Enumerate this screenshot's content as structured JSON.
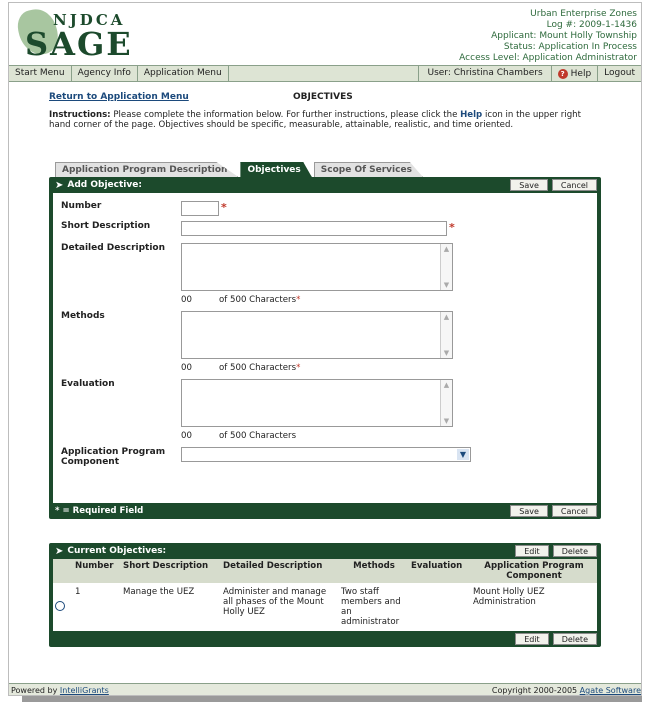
{
  "brand": {
    "top": "NJDCA",
    "main": "SAGE"
  },
  "app_info": {
    "line1": "Urban Enterprise Zones",
    "line2": "Log #: 2009-1-1436",
    "line3": "Applicant: Mount Holly Township",
    "line4": "Status: Application In Process",
    "line5": "Access Level: Application Administrator"
  },
  "nav": {
    "start_menu": "Start Menu",
    "agency_info": "Agency Info",
    "application_menu": "Application Menu",
    "user": "User: Christina Chambers",
    "help": "Help",
    "logout": "Logout"
  },
  "page": {
    "return_link": "Return to Application Menu",
    "title": "OBJECTIVES",
    "instructions_label": "Instructions:",
    "instructions_a": " Please complete the information below. For further instructions, please click the ",
    "instructions_help": "Help",
    "instructions_b": " icon in the upper right hand corner of the page. Objectives should be specific, measurable, attainable, realistic, and time oriented."
  },
  "tabs": [
    {
      "label": "Application Program Description"
    },
    {
      "label": "Objectives"
    },
    {
      "label": "Scope Of Services"
    }
  ],
  "form": {
    "header": "Add Objective:",
    "save": "Save",
    "cancel": "Cancel",
    "number_label": "Number",
    "number_value": "",
    "short_label": "Short Description",
    "short_value": "",
    "detailed_label": "Detailed Description",
    "methods_label": "Methods",
    "evaluation_label": "Evaluation",
    "component_label": "Application Program Component",
    "component_value": "",
    "count_num": "00",
    "count_text": "of 500 Characters",
    "required_mark": "*",
    "required_note": "* = Required Field"
  },
  "current": {
    "header": "Current Objectives:",
    "edit": "Edit",
    "delete": "Delete",
    "columns": [
      "Number",
      "Short Description",
      "Detailed Description",
      "Methods",
      "Evaluation",
      "Application Program Component"
    ],
    "rows": [
      {
        "number": "1",
        "short": "Manage the UEZ",
        "detailed": "Administer and manage all phases of the Mount Holly UEZ",
        "methods": "Two staff members and an administrator",
        "evaluation": "",
        "component": "Mount Holly UEZ Administration"
      }
    ]
  },
  "footer": {
    "powered_prefix": "Powered by ",
    "powered_link": "IntelliGrants",
    "copyright_prefix": "Copyright 2000-2005 ",
    "copyright_link": "Agate Software"
  },
  "colors": {
    "brand_green": "#1c4a2c",
    "nav_bg": "#dde4d4",
    "required_red": "#c0392b"
  }
}
